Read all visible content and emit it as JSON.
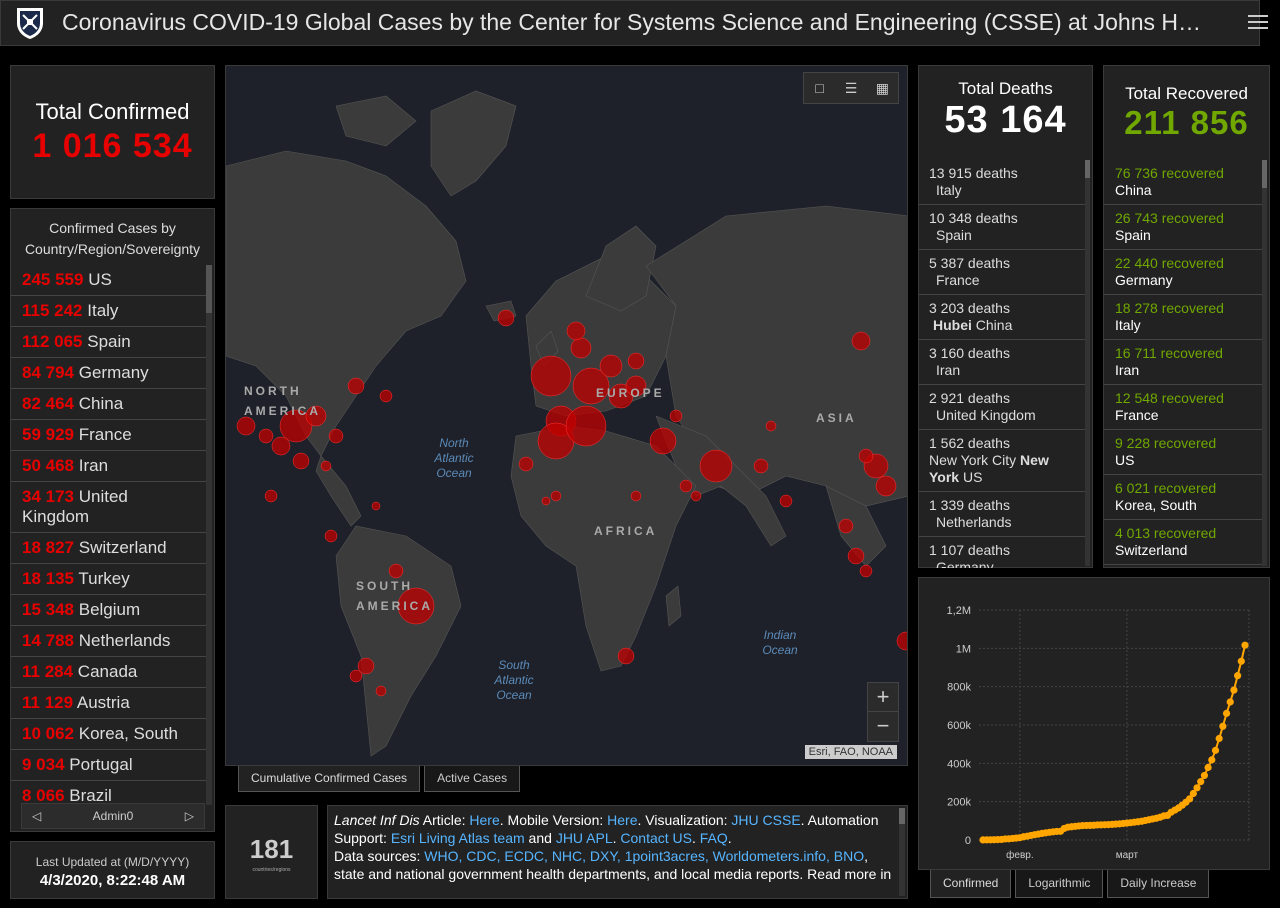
{
  "header": {
    "title": "Coronavirus COVID-19 Global Cases by the Center for Systems Science and Engineering (CSSE) at Johns Hopkins University (JHU)"
  },
  "total_confirmed": {
    "label": "Total Confirmed",
    "value": "1 016 534"
  },
  "country_list": {
    "header": "Confirmed Cases by Country/Region/Sovereignty",
    "items": [
      {
        "num": "245 559",
        "name": "US"
      },
      {
        "num": "115 242",
        "name": "Italy"
      },
      {
        "num": "112 065",
        "name": "Spain"
      },
      {
        "num": "84 794",
        "name": "Germany"
      },
      {
        "num": "82 464",
        "name": "China"
      },
      {
        "num": "59 929",
        "name": "France"
      },
      {
        "num": "50 468",
        "name": "Iran"
      },
      {
        "num": "34 173",
        "name": "United Kingdom"
      },
      {
        "num": "18 827",
        "name": "Switzerland"
      },
      {
        "num": "18 135",
        "name": "Turkey"
      },
      {
        "num": "15 348",
        "name": "Belgium"
      },
      {
        "num": "14 788",
        "name": "Netherlands"
      },
      {
        "num": "11 284",
        "name": "Canada"
      },
      {
        "num": "11 129",
        "name": "Austria"
      },
      {
        "num": "10 062",
        "name": "Korea, South"
      },
      {
        "num": "9 034",
        "name": "Portugal"
      },
      {
        "num": "8 066",
        "name": "Brazil"
      }
    ],
    "footer_label": "Admin0"
  },
  "last_updated": {
    "label": "Last Updated at (M/D/YYYY)",
    "value": "4/3/2020, 8:22:48 AM"
  },
  "map": {
    "labels": {
      "north_america": "NORTH AMERICA",
      "south_america": "SOUTH AMERICA",
      "europe": "EUROPE",
      "africa": "AFRICA",
      "asia": "ASIA",
      "north_atlantic": "North Atlantic Ocean",
      "south_atlantic": "South Atlantic Ocean",
      "indian_ocean": "Indian Ocean"
    },
    "attribution": "Esri, FAO, NOAA",
    "zoom_in": "+",
    "zoom_out": "−",
    "tabs": [
      "Cumulative Confirmed Cases",
      "Active Cases"
    ]
  },
  "country_count": {
    "value": "181",
    "label": "countries/regions"
  },
  "info": {
    "t1": "Lancet Inf Dis",
    "t2": " Article: ",
    "l1": "Here",
    "t3": ". Mobile Version: ",
    "l2": "Here",
    "t4": ". Visualization: ",
    "l3": "JHU CSSE",
    "t5": ". Automation Support: ",
    "l4": "Esri Living Atlas team",
    "t6": " and ",
    "l5": "JHU APL",
    "t7": ". ",
    "l6": "Contact US",
    "t8": ". ",
    "l7": "FAQ",
    "t9": ".",
    "t10": "Data sources: ",
    "l8": "WHO, CDC, ECDC, NHC, DXY, 1point3acres, Worldometers.info, BNO",
    "t11": ", state and national government health departments, and local media reports.  Read more in"
  },
  "total_deaths": {
    "label": "Total Deaths",
    "value": "53 164",
    "items": [
      {
        "line1": "13 915 deaths",
        "line2": "Italy"
      },
      {
        "line1": "10 348 deaths",
        "line2": "Spain"
      },
      {
        "line1": "5 387 deaths",
        "line2": "France"
      },
      {
        "line1": "3 203 deaths",
        "line2_bold": "Hubei",
        "line2": " China"
      },
      {
        "line1": "3 160 deaths",
        "line2": "Iran"
      },
      {
        "line1": "2 921 deaths",
        "line2": "United Kingdom"
      },
      {
        "line1": "1 562 deaths",
        "line2": "New York City ",
        "line2_bold": "New York",
        "line3": " US"
      },
      {
        "line1": "1 339 deaths",
        "line2": "Netherlands"
      },
      {
        "line1": "1 107 deaths",
        "line2": "Germany"
      }
    ]
  },
  "total_recovered": {
    "label": "Total Recovered",
    "value": "211 856",
    "items": [
      {
        "num": "76 736 recovered",
        "name": "China"
      },
      {
        "num": "26 743 recovered",
        "name": "Spain"
      },
      {
        "num": "22 440 recovered",
        "name": "Germany"
      },
      {
        "num": "18 278 recovered",
        "name": "Italy"
      },
      {
        "num": "16 711 recovered",
        "name": "Iran"
      },
      {
        "num": "12 548 recovered",
        "name": "France"
      },
      {
        "num": "9 228 recovered",
        "name": "US"
      },
      {
        "num": "6 021 recovered",
        "name": "Korea, South"
      },
      {
        "num": "4 013 recovered",
        "name": "Switzerland"
      }
    ]
  },
  "chart_tabs": [
    "Confirmed",
    "Logarithmic",
    "Daily Increase"
  ],
  "chart_data": {
    "type": "line",
    "title": "",
    "xlabel": "",
    "ylabel": "",
    "ylim": [
      0,
      1200000
    ],
    "y_ticks": [
      "0",
      "200k",
      "400k",
      "600k",
      "800k",
      "1M",
      "1,2M"
    ],
    "x_ticks": [
      "февр.",
      "март"
    ],
    "x_tick_days": [
      10,
      39
    ],
    "color": "#ffa500",
    "series": [
      {
        "x": [
          0,
          1,
          2,
          3,
          4,
          5,
          6,
          7,
          8,
          9,
          10,
          11,
          12,
          13,
          14,
          15,
          16,
          17,
          18,
          19,
          20,
          21,
          22,
          23,
          24,
          25,
          26,
          27,
          28,
          29,
          30,
          31,
          32,
          33,
          34,
          35,
          36,
          37,
          38,
          39,
          40,
          41,
          42,
          43,
          44,
          45,
          46,
          47,
          48,
          49,
          50,
          51,
          52,
          53,
          54,
          55,
          56,
          57,
          58,
          59,
          60,
          61,
          62,
          63,
          64,
          65,
          66,
          67,
          68,
          69,
          70,
          71
        ],
        "values": [
          555,
          654,
          941,
          1434,
          2118,
          2927,
          5578,
          6166,
          8234,
          9927,
          12038,
          16787,
          19881,
          23892,
          27635,
          30817,
          34391,
          37120,
          40150,
          42762,
          44802,
          45221,
          60368,
          66885,
          69030,
          71224,
          73258,
          75136,
          75639,
          76197,
          76819,
          78572,
          78958,
          79561,
          80406,
          81388,
          82746,
          84112,
          86011,
          88369,
          90306,
          92840,
          95120,
          97886,
          101801,
          105847,
          109821,
          113590,
          118620,
          125875,
          128352,
          145205,
          156101,
          167454,
          181574,
          197102,
          214821,
          242570,
          272208,
          304507,
          336953,
          378235,
          418045,
          467653,
          529591,
          593291,
          660706,
          720117,
          782365,
          857487,
          932605,
          1016534
        ]
      }
    ]
  }
}
